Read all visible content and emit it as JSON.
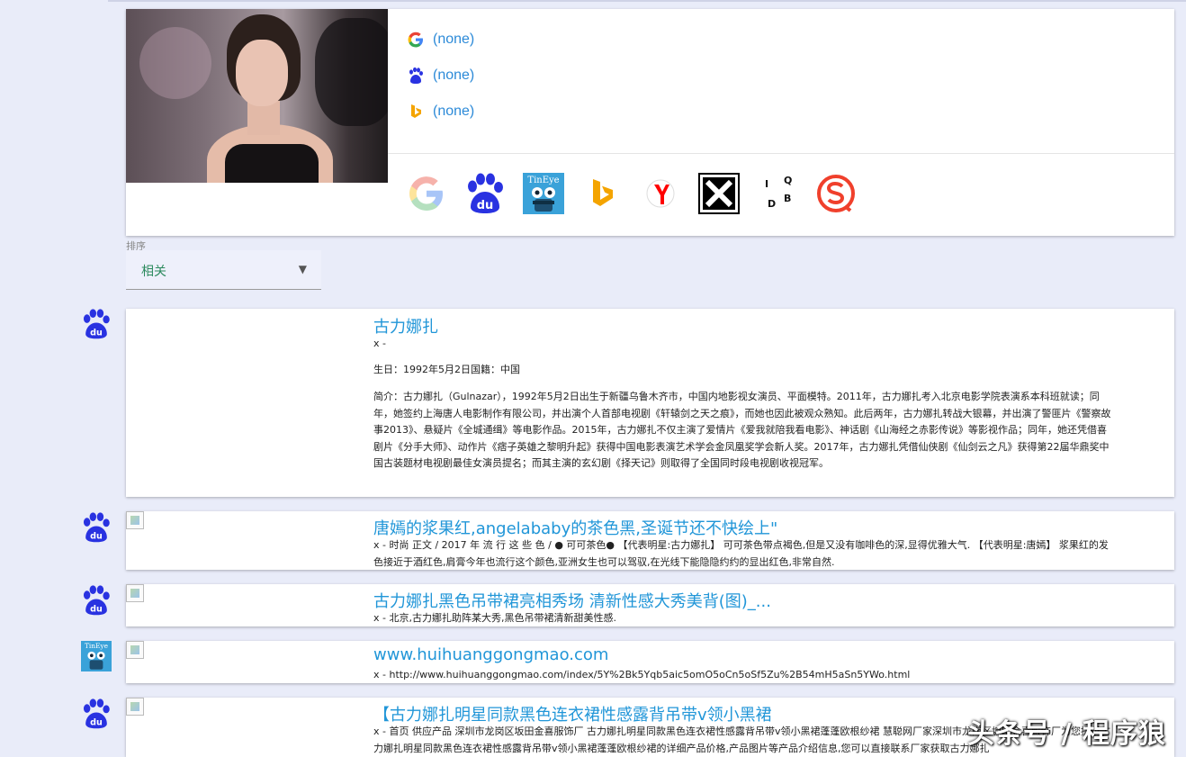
{
  "query": {
    "engines": [
      {
        "icon": "google-icon",
        "link": "(none)"
      },
      {
        "icon": "baidu-icon",
        "link": "(none)"
      },
      {
        "icon": "bing-icon",
        "link": "(none)"
      }
    ],
    "services": [
      {
        "icon": "google-logo-icon"
      },
      {
        "icon": "baidu-logo-icon",
        "text": "du"
      },
      {
        "icon": "tineye-logo-icon",
        "text": "TinEye"
      },
      {
        "icon": "bing-logo-icon"
      },
      {
        "icon": "yandex-logo-icon"
      },
      {
        "icon": "karma-decay-logo-icon"
      },
      {
        "icon": "iqdb-logo-icon",
        "letters": [
          "I",
          "Q",
          "D",
          "B"
        ]
      },
      {
        "icon": "sogou-logo-icon"
      }
    ]
  },
  "sort": {
    "label": "排序",
    "value": "相关"
  },
  "results": [
    {
      "source_icon": "baidu-icon",
      "title": "古力娜扎",
      "lines": [
        "x -",
        "生日：1992年5月2日国籍：中国",
        "简介：古力娜扎（Gulnazar），1992年5月2日出生于新疆乌鲁木齐市，中国内地影视女演员、平面模特。2011年，古力娜扎考入北京电影学院表演系本科班就读；同年，她签约上海唐人电影制作有限公司，并出演个人首部电视剧《轩辕剑之天之痕》，而她也因此被观众熟知。此后两年，古力娜扎转战大银幕，并出演了警匪片《警察故事2013》、悬疑片《全城通缉》等电影作品。2015年，古力娜扎不仅主演了爱情片《爱我就陪我看电影》、神话剧《山海经之赤影传说》等影视作品；同年，她还凭借喜剧片《分手大师》、动作片《痞子英雄之黎明升起》获得中国电影表演艺术学会金凤凰奖学会新人奖。2017年，古力娜扎凭借仙侠剧《仙剑云之凡》获得第22届华鼎奖中国古装题材电视剧最佳女演员提名；而其主演的玄幻剧《择天记》则取得了全国同时段电视剧收视冠军。"
      ]
    },
    {
      "source_icon": "baidu-icon",
      "title": "唐嫣的浆果红,angelababy的茶色黑,圣诞节还不快绘上\"",
      "lines": [
        "x - 时尚 正文 / 2017 年 流 行 这 些 色 / ● 可可茶色● 【代表明星:古力娜扎】 可可茶色带点褐色,但是又没有咖啡色的深,显得优雅大气. 【代表明星:唐嫣】 浆果红的发色接近于酒红色,肩膏今年也流行这个颜色,亚洲女生也可以驾驭,在光线下能隐隐约约的显出红色,非常自然."
      ]
    },
    {
      "source_icon": "baidu-icon",
      "title": "古力娜扎黑色吊带裙亮相秀场 清新性感大秀美背(图)_...",
      "lines": [
        "x - 北京,古力娜扎助阵某大秀,黑色吊带裙清新甜美性感."
      ]
    },
    {
      "source_icon": "tineye-icon",
      "title": "www.huihuanggongmao.com",
      "lines": [
        "x - http://www.huihuanggongmao.com/index/5Y%2Bk5Yqb5aic5omO5oCn5oSf5Zu%2B54mH5aSn5YWo.html"
      ]
    },
    {
      "source_icon": "baidu-icon",
      "title": "【古力娜扎明星同款黑色连衣裙性感露背吊带v领小黑裙",
      "lines": [
        "x - 首页 供应产品 深圳市龙岗区坂田金喜服饰厂 古力娜扎明星同款黑色连衣裙性感露背吊带v领小黑裙蓬蓬欧根纱裙 慧聪网厂家深圳市龙岗区坂田金喜服饰厂为您提供古力娜扎明星同款黑色连衣裙性感露背吊带v领小黑裙蓬蓬欧根纱裙的详细产品价格,产品图片等产品介绍信息,您可以直接联系厂家获取古力娜扎"
      ]
    }
  ],
  "watermark": "头条号 / 程序狼",
  "colors": {
    "accent": "#2196d8",
    "link": "#2c8ad8",
    "sort_text": "#2c8a5e",
    "background": "#e9ecf9",
    "baidu_blue": "#2932e1"
  }
}
